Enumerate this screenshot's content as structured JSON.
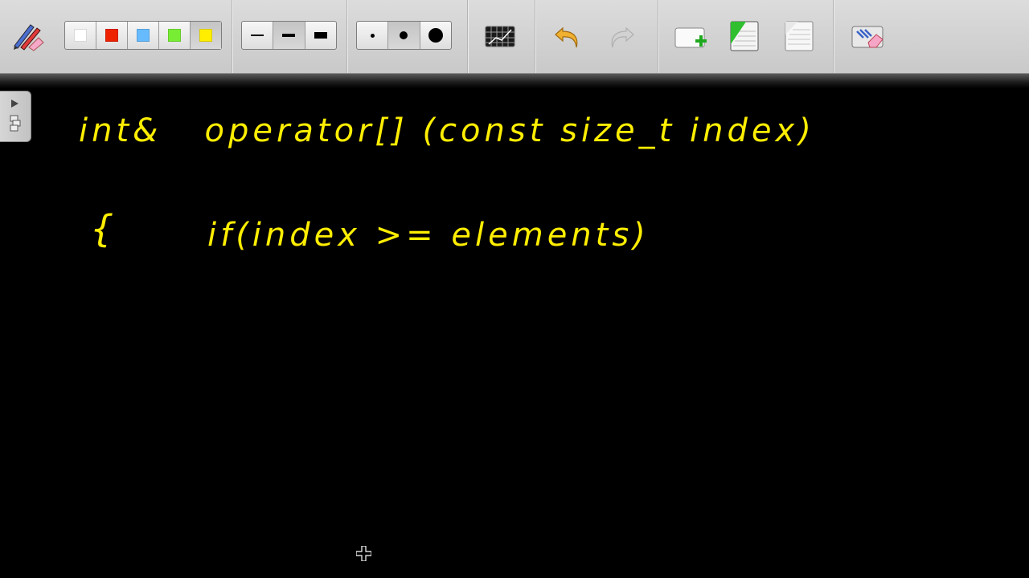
{
  "toolbar": {
    "colors": [
      "#ffffff",
      "#ee2200",
      "#66bbff",
      "#77ee33",
      "#ffee00"
    ],
    "selected_color": "#ffee00",
    "line_widths": [
      "thin",
      "medium",
      "thick"
    ],
    "selected_line_width": "medium",
    "dot_sizes": [
      "small",
      "medium",
      "large"
    ],
    "selected_dot_size": "medium",
    "tools": [
      "pen-eraser-icon",
      "grid-icon",
      "undo-icon",
      "redo-icon",
      "add-page-icon",
      "page-green-icon",
      "page-icon",
      "clear-eraser-icon"
    ]
  },
  "board": {
    "background": "#000000",
    "ink_color": "#ffee00",
    "line1": "int&   operator[] (const size_t index)",
    "line2_brace": "{",
    "line2_code": "if(index >= elements)"
  }
}
